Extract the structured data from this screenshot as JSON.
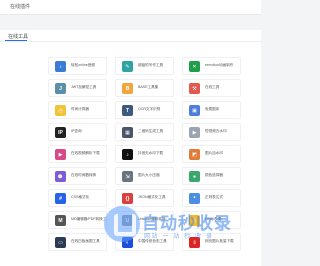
{
  "header": {
    "title": "在线插件"
  },
  "section": {
    "label": "在线工具"
  },
  "tools": [
    {
      "label": "轻松online音频",
      "icon": "audio-wave-icon",
      "color": "#3a7bd5"
    },
    {
      "label": "超级的写作工具",
      "icon": "writing-icon",
      "color": "#2fa4a4"
    },
    {
      "label": "remotion动画制作",
      "icon": "xmind-icon",
      "color": "#1f9e4c"
    },
    {
      "label": "JWT加解密工具",
      "icon": "jwt-icon",
      "color": "#5a8fa8"
    },
    {
      "label": "BASE工具集",
      "icon": "base-icon",
      "color": "#f0a63c"
    },
    {
      "label": "在线工具",
      "icon": "toolbox-icon",
      "color": "#e05a4f"
    },
    {
      "label": "时间计算器",
      "icon": "clock-icon",
      "color": "#f2c23a"
    },
    {
      "label": "OCR文字识别",
      "icon": "ocr-icon",
      "color": "#3d5a80"
    },
    {
      "label": "免费图床",
      "icon": "image-host-icon",
      "color": "#4f7ddb"
    },
    {
      "label": "IP查询",
      "icon": "ip-icon",
      "color": "#222222"
    },
    {
      "label": "二维码生成工具",
      "icon": "qrcode-icon",
      "color": "#4a5568"
    },
    {
      "label": "短视频去水印",
      "icon": "video-icon",
      "color": "#9aa5b1"
    },
    {
      "label": "在线视频解析下载",
      "icon": "play-icon",
      "color": "#d64a8a"
    },
    {
      "label": "抖音无水印下载",
      "icon": "tiktok-icon",
      "color": "#111111"
    },
    {
      "label": "图片加水印",
      "icon": "photo-icon",
      "color": "#e07b39"
    },
    {
      "label": "在线时间戳转换",
      "icon": "timestamp-icon",
      "color": "#7b5ae0"
    },
    {
      "label": "图片大小压缩",
      "icon": "compress-icon",
      "color": "#6b7280"
    },
    {
      "label": "颜色选择器",
      "icon": "color-picker-icon",
      "color": "#39a86b"
    },
    {
      "label": "CSS格式化",
      "icon": "css-icon",
      "color": "#2563eb"
    },
    {
      "label": "JSON格式化工具",
      "icon": "json-icon",
      "color": "#d94040"
    },
    {
      "label": "正则表达式",
      "icon": "regex-icon",
      "color": "#4b8fe0"
    },
    {
      "label": "MD编辑器/PDF转换工具",
      "icon": "markdown-icon",
      "color": "#555555"
    },
    {
      "label": "Unicode编码转换",
      "icon": "unicode-icon",
      "color": "#8a94a6"
    },
    {
      "label": "Emoji表情",
      "icon": "emoji-icon",
      "color": "#f5b82e"
    },
    {
      "label": "在线白板画图工具",
      "icon": "whiteboard-icon",
      "color": "#2b3a55"
    },
    {
      "label": "中国传统色彩工具",
      "icon": "palette-icon",
      "color": "#1d4ed8"
    },
    {
      "label": "网页图片批量下载",
      "icon": "download-icon",
      "color": "#dc2626"
    }
  ],
  "watermark": {
    "title": "自动秒收录",
    "subtitle": "网站 一 站 秒 收 录"
  }
}
